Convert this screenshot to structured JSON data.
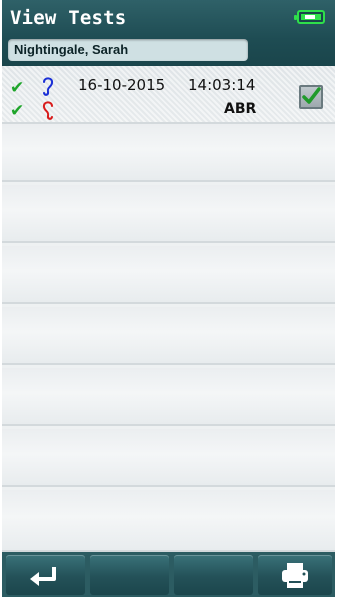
{
  "header": {
    "title": "View Tests",
    "patient_name": "Nightingale, Sarah",
    "battery_icon": "battery-charging-icon"
  },
  "tests": [
    {
      "date": "16-10-2015",
      "time": "14:03:14",
      "type": "ABR",
      "right_ear_result": "pass",
      "left_ear_result": "pass",
      "selected": true
    }
  ],
  "empty_rows": 7,
  "footer": {
    "buttons": [
      {
        "icon": "back-arrow-icon"
      },
      {
        "icon": ""
      },
      {
        "icon": ""
      },
      {
        "icon": "printer-icon"
      }
    ]
  },
  "colors": {
    "header": "#1e4c53",
    "pass_check": "#1fa52b",
    "right_ear": "#1a2fd6",
    "left_ear": "#d81c1c",
    "battery": "#2ee04a"
  }
}
